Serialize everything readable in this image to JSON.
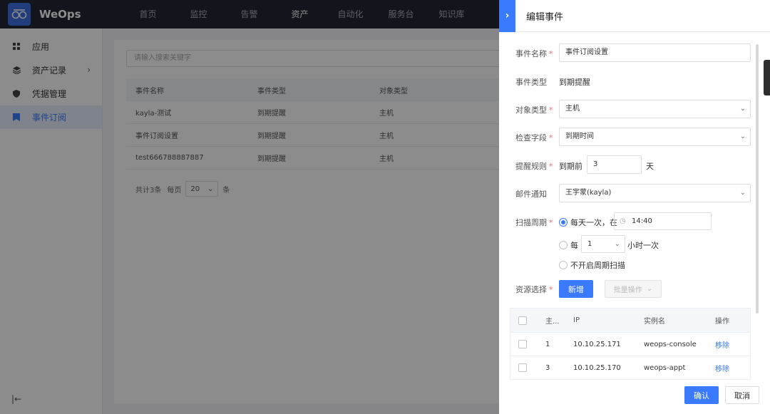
{
  "app": {
    "brand": "WeOps"
  },
  "topnav": [
    {
      "label": "首页",
      "active": false
    },
    {
      "label": "监控",
      "active": false
    },
    {
      "label": "告警",
      "active": false
    },
    {
      "label": "资产",
      "active": true
    },
    {
      "label": "自动化",
      "active": false
    },
    {
      "label": "服务台",
      "active": false
    },
    {
      "label": "知识库",
      "active": false
    }
  ],
  "sidebar": {
    "items": [
      {
        "label": "应用",
        "icon": "grid-icon"
      },
      {
        "label": "资产记录",
        "icon": "layers-icon"
      },
      {
        "label": "凭据管理",
        "icon": "shield-icon"
      },
      {
        "label": "事件订阅",
        "icon": "bookmark-icon"
      }
    ],
    "collapse_icon": "|←"
  },
  "main": {
    "search_placeholder": "请输入搜索关键字",
    "table": {
      "headers": [
        "事件名称",
        "事件类型",
        "对象类型"
      ],
      "rows": [
        [
          "kayla-测试",
          "到期提醒",
          "主机"
        ],
        [
          "事件订阅设置",
          "到期提醒",
          "主机"
        ],
        [
          "test666788887887",
          "到期提醒",
          "主机"
        ]
      ]
    },
    "pager": {
      "total": "共计3条",
      "per_page_label": "每页",
      "per_page": "20",
      "unit": "条"
    }
  },
  "drawer": {
    "title": "编辑事件",
    "fields": {
      "name_label": "事件名称",
      "name_value": "事件订阅设置",
      "type_label": "事件类型",
      "type_value": "到期提醒",
      "object_label": "对象类型",
      "object_value": "主机",
      "check_label": "检查字段",
      "check_value": "到期时间",
      "rule_label": "提醒规则",
      "rule_prefix": "到期前",
      "rule_days": "3",
      "rule_unit": "天",
      "mail_label": "邮件通知",
      "mail_value": "王宇蒙(kayla)",
      "scan_label": "扫描周期",
      "scan_opt1": "每天一次，在",
      "scan_time": "14:40",
      "scan_opt2_prefix": "每",
      "scan_hours": "1",
      "scan_opt2_suffix": "小时一次",
      "scan_opt3": "不开启周期扫描",
      "res_label": "资源选择",
      "add_btn": "新增",
      "batch_btn": "批量操作"
    },
    "resource_table": {
      "headers": [
        "主...",
        "IP",
        "实例名",
        "操作"
      ],
      "rows": [
        {
          "id": "1",
          "ip": "10.10.25.171",
          "name": "weops-console",
          "action": "移除"
        },
        {
          "id": "3",
          "ip": "10.10.25.170",
          "name": "weops-appt",
          "action": "移除"
        }
      ]
    },
    "confirm_btn": "确认",
    "cancel_btn": "取消"
  },
  "colors": {
    "accent": "#3a7afe",
    "topbar": "#232733",
    "required": "#f56c6c"
  }
}
